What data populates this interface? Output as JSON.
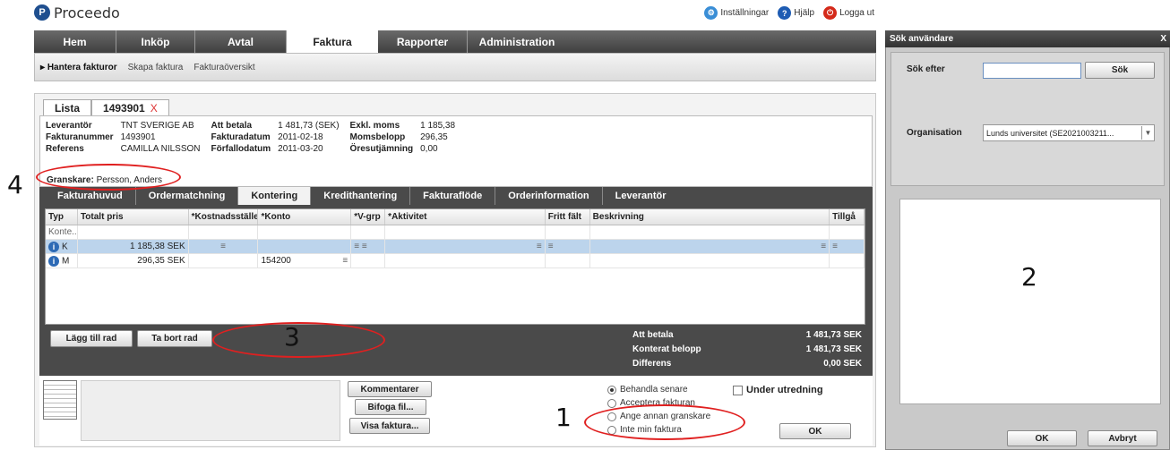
{
  "app": {
    "name": "Proceedo",
    "logo_glyph": "P"
  },
  "toplinks": [
    {
      "label": "Inställningar",
      "icon": "settings-people-icon",
      "glyph": "⚙",
      "color": "#3a8ed6"
    },
    {
      "label": "Hjälp",
      "icon": "help-icon",
      "glyph": "?",
      "color": "#1e5cb3"
    },
    {
      "label": "Logga ut",
      "icon": "logout-icon",
      "glyph": "⏻",
      "color": "#d42a1a"
    }
  ],
  "nav": [
    "Hem",
    "Inköp",
    "Avtal",
    "Faktura",
    "Rapporter",
    "Administration"
  ],
  "nav_active": "Faktura",
  "subnav": {
    "current": "Hantera fakturor",
    "items": [
      "Skapa faktura",
      "Fakturaöversikt"
    ]
  },
  "doc_tabs": {
    "list": "Lista",
    "invoice": "1493901",
    "close": "X"
  },
  "invoice": {
    "rows": [
      [
        {
          "l": "Leverantör",
          "v": "TNT SVERIGE AB"
        },
        {
          "l": "Att betala",
          "v": "1 481,73 (SEK)"
        },
        {
          "l": "Exkl. moms",
          "v": "1 185,38"
        }
      ],
      [
        {
          "l": "Fakturanummer",
          "v": "1493901"
        },
        {
          "l": "Fakturadatum",
          "v": "2011-02-18"
        },
        {
          "l": "Momsbelopp",
          "v": "296,35"
        }
      ],
      [
        {
          "l": "Referens",
          "v": "CAMILLA NILSSON"
        },
        {
          "l": "Förfallodatum",
          "v": "2011-03-20"
        },
        {
          "l": "Öresutjämning",
          "v": "0,00"
        }
      ]
    ],
    "granskare_label": "Granskare:",
    "granskare_value": "Persson, Anders"
  },
  "kontering_tabs": [
    "Fakturahuvud",
    "Ordermatchning",
    "Kontering",
    "Kredithantering",
    "Fakturaflöde",
    "Orderinformation",
    "Leverantör"
  ],
  "kontering_active": "Kontering",
  "grid": {
    "headers": [
      "Typ",
      "Totalt pris",
      "*Kostnadsställe",
      "*Konto",
      "*V-grp",
      "*Aktivitet",
      "Fritt fält",
      "Beskrivning",
      "Tillgå"
    ],
    "placeholder": "Konte...",
    "rows": [
      {
        "typ": "K",
        "pris": "1 185,38 SEK",
        "konto": "",
        "selected": true
      },
      {
        "typ": "M",
        "pris": "296,35 SEK",
        "konto": "154200",
        "selected": false
      }
    ]
  },
  "buttons": {
    "add_row": "Lägg till rad",
    "remove_row": "Ta bort rad",
    "comments": "Kommentarer",
    "attach": "Bifoga fil...",
    "show_invoice": "Visa faktura...",
    "ok": "OK"
  },
  "summary": [
    {
      "label": "Att betala",
      "value": "1 481,73 SEK"
    },
    {
      "label": "Konterat belopp",
      "value": "1 481,73 SEK"
    },
    {
      "label": "Differens",
      "value": "0,00 SEK"
    }
  ],
  "radios": [
    {
      "label": "Behandla senare",
      "checked": true
    },
    {
      "label": "Acceptera fakturan",
      "checked": false
    },
    {
      "label": "Ange annan granskare",
      "checked": false
    },
    {
      "label": "Inte min faktura",
      "checked": false
    }
  ],
  "under_utredning": "Under utredning",
  "annotations": [
    "1",
    "2",
    "3",
    "4"
  ],
  "dialog": {
    "title": "Sök användare",
    "close": "X",
    "search_label": "Sök efter",
    "search_value": "",
    "search_button": "Sök",
    "org_label": "Organisation",
    "org_value": "Lunds universitet (SE2021003211...",
    "ok": "OK",
    "cancel": "Avbryt"
  },
  "colors": {
    "annotation_ellipse": "#e02020",
    "selected_row": "#bcd4ec",
    "nav_bg": "#4a4a4a"
  }
}
